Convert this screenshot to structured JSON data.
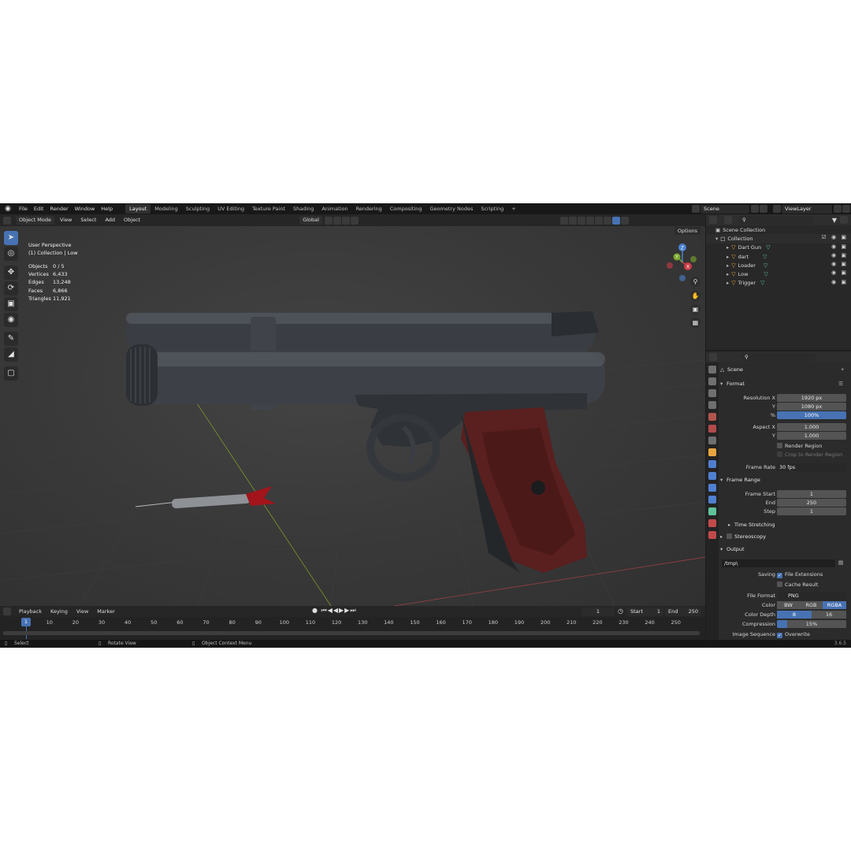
{
  "menu": {
    "items": [
      "File",
      "Edit",
      "Render",
      "Window",
      "Help"
    ],
    "workspaces": [
      "Layout",
      "Modeling",
      "Sculpting",
      "UV Editing",
      "Texture Paint",
      "Shading",
      "Animation",
      "Rendering",
      "Compositing",
      "Geometry Nodes",
      "Scripting"
    ],
    "active_workspace": "Layout",
    "add_tab": "+",
    "scene_name": "Scene",
    "view_layer": "ViewLayer"
  },
  "viewport_header": {
    "mode": "Object Mode",
    "menus": [
      "View",
      "Select",
      "Add",
      "Object"
    ],
    "orientation": "Global",
    "options_label": "Options"
  },
  "viewport": {
    "perspective": "User Perspective",
    "collection_info": "(1) Collection | Low",
    "stats": [
      {
        "label": "Objects",
        "value": "0 / 5"
      },
      {
        "label": "Vertices",
        "value": "6,433"
      },
      {
        "label": "Edges",
        "value": "13,248"
      },
      {
        "label": "Faces",
        "value": "6,866"
      },
      {
        "label": "Triangles",
        "value": "11,921"
      }
    ],
    "gizmo_axes": [
      "Z",
      "Y",
      "X"
    ]
  },
  "timeline": {
    "menus": [
      "Playback",
      "Keying",
      "View",
      "Marker"
    ],
    "current_frame": "1",
    "start_label": "Start",
    "start_value": "1",
    "end_label": "End",
    "end_value": "250",
    "ruler": [
      "1",
      "10",
      "20",
      "30",
      "40",
      "50",
      "60",
      "70",
      "80",
      "90",
      "100",
      "110",
      "120",
      "130",
      "140",
      "150",
      "160",
      "170",
      "180",
      "190",
      "200",
      "210",
      "220",
      "230",
      "240",
      "250"
    ]
  },
  "statusbar": {
    "select": "Select",
    "rotate": "Rotate View",
    "context": "Object Context Menu",
    "version": "3.6.5"
  },
  "outliner": {
    "root": "Scene Collection",
    "collection": "Collection",
    "objects": [
      "Dart Gun",
      "dart",
      "Loader",
      "Low",
      "Trigger"
    ]
  },
  "properties": {
    "context": "Scene",
    "format": {
      "title": "Format",
      "resolution_x_label": "Resolution X",
      "resolution_x": "1920 px",
      "resolution_y_label": "Y",
      "resolution_y": "1080 px",
      "percent_label": "%",
      "percent": "100%",
      "aspect_x_label": "Aspect X",
      "aspect_x": "1.000",
      "aspect_y_label": "Y",
      "aspect_y": "1.000",
      "render_region": "Render Region",
      "crop_region": "Crop to Render Region",
      "frame_rate_label": "Frame Rate",
      "frame_rate": "30 fps"
    },
    "frame_range": {
      "title": "Frame Range",
      "start_label": "Frame Start",
      "start": "1",
      "end_label": "End",
      "end": "250",
      "step_label": "Step",
      "step": "1",
      "time_stretching": "Time Stretching",
      "stereoscopy": "Stereoscopy"
    },
    "output": {
      "title": "Output",
      "path": "/tmp\\",
      "saving_label": "Saving",
      "file_extensions": "File Extensions",
      "cache_result": "Cache Result",
      "file_format_label": "File Format",
      "file_format": "PNG",
      "color_label": "Color",
      "color_options": [
        "BW",
        "RGB",
        "RGBA"
      ],
      "color_selected": "RGBA",
      "depth_label": "Color Depth",
      "depth_options": [
        "8",
        "16"
      ],
      "depth_selected": "8",
      "compression_label": "Compression",
      "compression": "15%",
      "image_sequence_label": "Image Sequence",
      "overwrite": "Overwrite"
    }
  },
  "colors": {
    "accent": "#4772b3",
    "background": "#1d1d1d",
    "outliner_object": "#e7a53f",
    "mesh_data": "#5fc29a"
  }
}
